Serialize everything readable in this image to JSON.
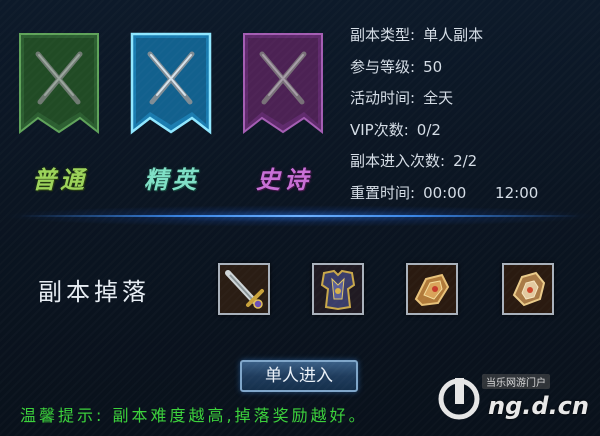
{
  "difficulty_tabs": [
    {
      "label": "普通",
      "color": "#9cd35a",
      "banner_color": "#2f6b34"
    },
    {
      "label": "精英",
      "color": "#7fe0c6",
      "banner_color": "#1e8ec0",
      "selected": true
    },
    {
      "label": "史诗",
      "color": "#c86fd6",
      "banner_color": "#6b2f7a"
    }
  ],
  "dungeon_info": [
    {
      "label": "副本类型:",
      "value": "单人副本"
    },
    {
      "label": "参与等级:",
      "value": "50"
    },
    {
      "label": "活动时间:",
      "value": "全天"
    },
    {
      "label": "VIP次数:",
      "value": "0/2"
    },
    {
      "label": "副本进入次数:",
      "value": "2/2"
    },
    {
      "label": "重置时间:",
      "value": "00:00 12:00"
    }
  ],
  "drops": {
    "title": "副本掉落",
    "items": [
      {
        "icon": "sword-item-icon"
      },
      {
        "icon": "armor-item-icon"
      },
      {
        "icon": "gauntlet-item-icon"
      },
      {
        "icon": "bracer-item-icon"
      }
    ]
  },
  "enter_button": {
    "label": "单人进入"
  },
  "tip": "温馨提示: 副本难度越高,掉落奖励越好。",
  "watermark": {
    "small": "当乐网游门户",
    "big": "ng.d.cn"
  },
  "colors": {
    "accent_blue": "#3a86e6",
    "tip_green": "#3bd13b"
  }
}
